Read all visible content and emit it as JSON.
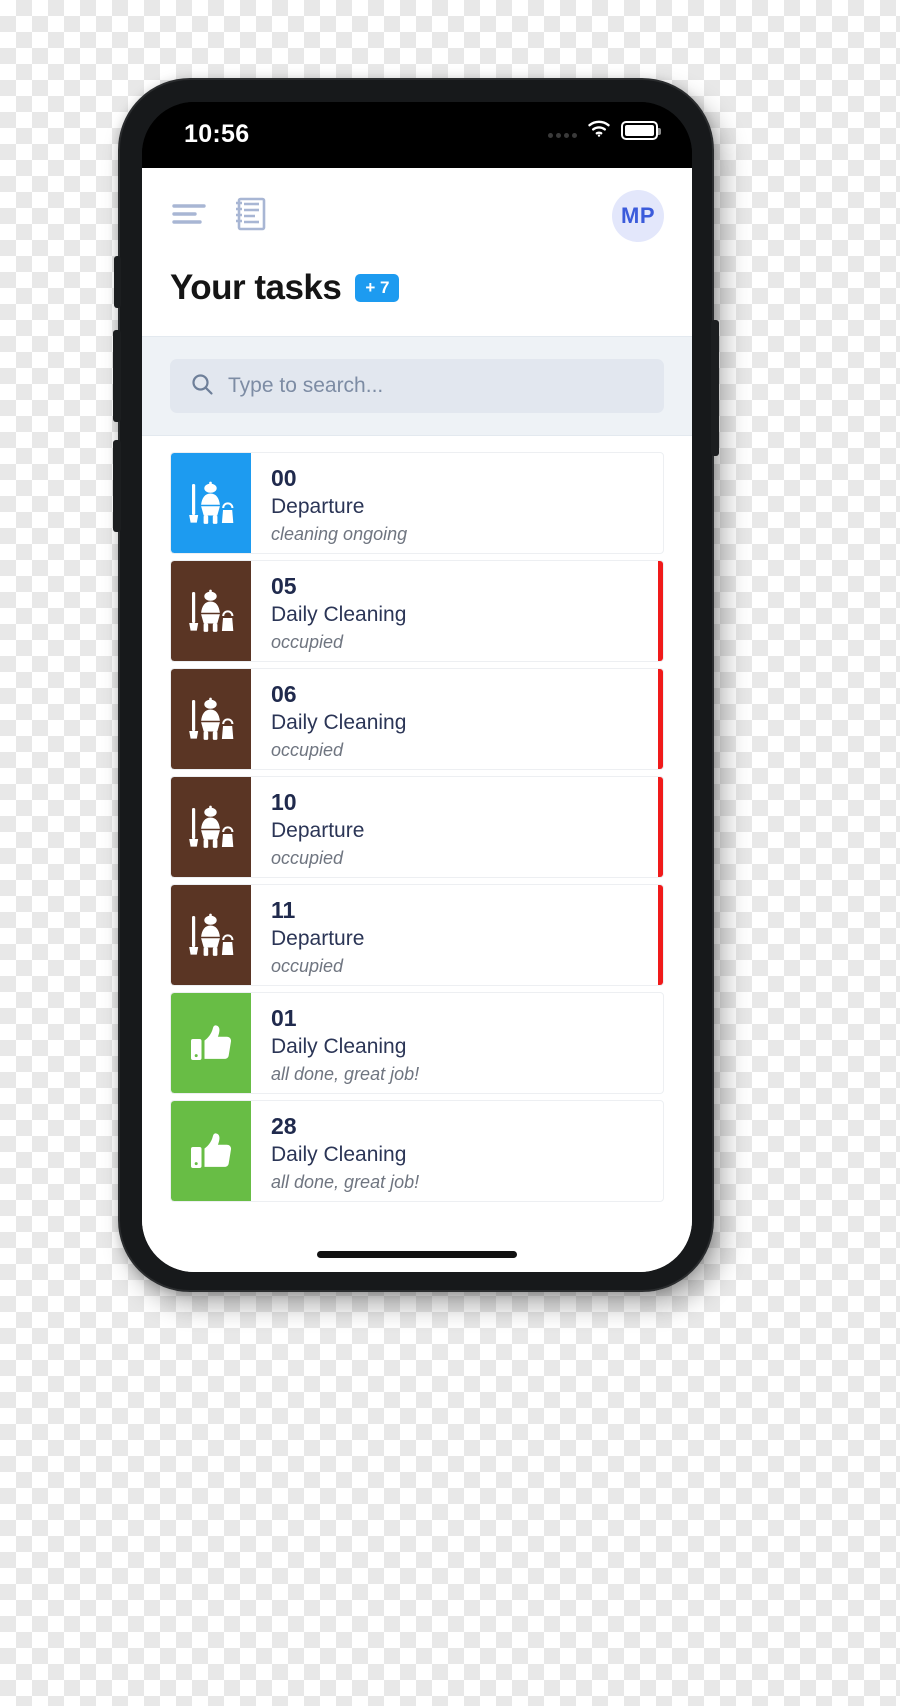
{
  "status_bar": {
    "time": "10:56",
    "signal_icon": "signal-dots-icon",
    "wifi_icon": "wifi-icon",
    "battery_icon": "battery-full-icon"
  },
  "header": {
    "menu_icon": "hamburger-list-icon",
    "notes_icon": "notebook-icon",
    "avatar_initials": "MP"
  },
  "title": {
    "text": "Your tasks",
    "badge": "+ 7"
  },
  "search": {
    "placeholder": "Type to search...",
    "value": "",
    "icon": "search-icon"
  },
  "colors": {
    "blue": "#1d9bf0",
    "brown": "#5a3524",
    "green": "#68bd45",
    "red_flag": "#f01a1a",
    "avatar_bg": "#e3e7fb",
    "avatar_text": "#3b5bdb",
    "search_bg": "#e2e7ef",
    "panel_bg": "#eef2f6"
  },
  "tasks": [
    {
      "number": "00",
      "type": "Departure",
      "status": "cleaning ongoing",
      "thumb_color": "#1d9bf0",
      "thumb_icon": "cleaning-person-icon",
      "flag": false
    },
    {
      "number": "05",
      "type": "Daily Cleaning",
      "status": "occupied",
      "thumb_color": "#5a3524",
      "thumb_icon": "cleaning-person-icon",
      "flag": true
    },
    {
      "number": "06",
      "type": "Daily Cleaning",
      "status": "occupied",
      "thumb_color": "#5a3524",
      "thumb_icon": "cleaning-person-icon",
      "flag": true
    },
    {
      "number": "10",
      "type": "Departure",
      "status": "occupied",
      "thumb_color": "#5a3524",
      "thumb_icon": "cleaning-person-icon",
      "flag": true
    },
    {
      "number": "11",
      "type": "Departure",
      "status": "occupied",
      "thumb_color": "#5a3524",
      "thumb_icon": "cleaning-person-icon",
      "flag": true
    },
    {
      "number": "01",
      "type": "Daily Cleaning",
      "status": "all done, great job!",
      "thumb_color": "#68bd45",
      "thumb_icon": "thumbs-up-icon",
      "flag": false
    },
    {
      "number": "28",
      "type": "Daily Cleaning",
      "status": "all done, great job!",
      "thumb_color": "#68bd45",
      "thumb_icon": "thumbs-up-icon",
      "flag": false
    }
  ]
}
